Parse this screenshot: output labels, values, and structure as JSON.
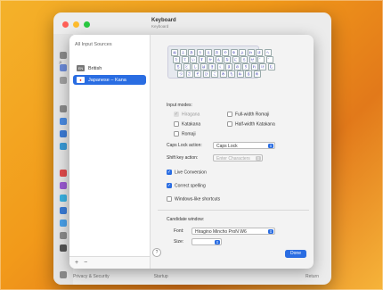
{
  "window": {
    "title": "Keyboard",
    "subtitle": "Keyboard"
  },
  "background_labels": {
    "bottom_left": "Privacy & Security",
    "bottom_mid": "Startup",
    "bottom_right": "Return"
  },
  "sheet": {
    "sources_heading": "All Input Sources",
    "sources": [
      {
        "flag": "EN",
        "label": "British",
        "selected": false
      },
      {
        "flag": "●",
        "label": "Japanese – Kana",
        "selected": true
      }
    ],
    "add_label": "+",
    "remove_label": "−",
    "keyboard_keys": [
      [
        "ぬ",
        "ふ",
        "あ",
        "う",
        "え",
        "お",
        "や",
        "ゆ",
        "よ",
        "わ",
        "ほ",
        "へ"
      ],
      [
        "た",
        "て",
        "い",
        "す",
        "か",
        "ん",
        "な",
        "に",
        "ら",
        "せ",
        "゛",
        "゜"
      ],
      [
        "ち",
        "と",
        "し",
        "は",
        "き",
        "く",
        "ま",
        "の",
        "り",
        "れ",
        "け",
        "む"
      ],
      [
        "つ",
        "さ",
        "そ",
        "ひ",
        "こ",
        "み",
        "も",
        "ね",
        "る",
        "め"
      ]
    ],
    "input_modes_heading": "Input modes:",
    "input_modes": [
      {
        "label": "Hiragana",
        "state": "dim"
      },
      {
        "label": "Full-width Romaji",
        "state": "off"
      },
      {
        "label": "Katakana",
        "state": "off"
      },
      {
        "label": "Half-width Katakana",
        "state": "off"
      },
      {
        "label": "Romaji",
        "state": "off"
      }
    ],
    "caps_lock_label": "Caps Lock action:",
    "caps_lock_value": "Caps Lock",
    "shift_key_label": "Shift key action:",
    "shift_key_value": "Enter Characters",
    "options": [
      {
        "label": "Live Conversion",
        "checked": true
      },
      {
        "label": "Correct spelling",
        "checked": true
      },
      {
        "label": "Windows-like shortcuts",
        "checked": false
      }
    ],
    "candidate_heading": "Candidate window:",
    "font_label": "Font:",
    "font_value": "Hiragino Mincho ProN W6",
    "size_label": "Size:",
    "size_value": "",
    "help_label": "?",
    "done_label": "Done"
  },
  "colors": {
    "accent": "#2a6de2",
    "wallpaper": "#f29a1a"
  }
}
